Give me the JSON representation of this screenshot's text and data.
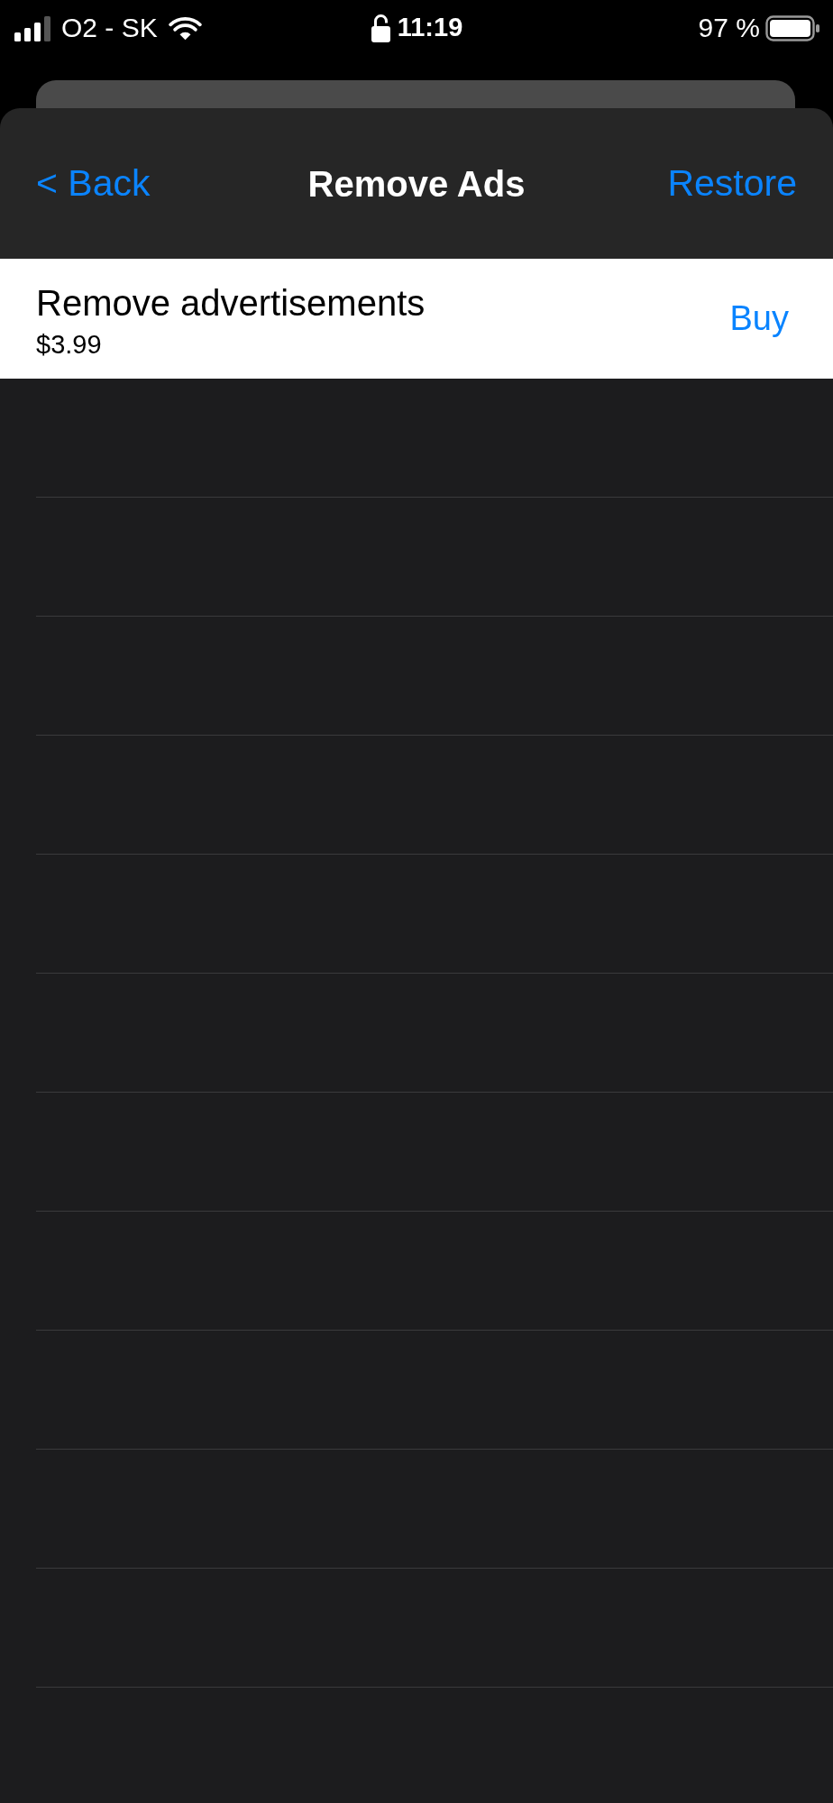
{
  "status_bar": {
    "carrier": "O2 - SK",
    "time": "11:19",
    "battery": "97 %"
  },
  "nav_bar": {
    "back": "< Back",
    "title": "Remove Ads",
    "action": "Restore"
  },
  "products": [
    {
      "name": "Remove advertisements",
      "price": "$3.99",
      "button": "Buy"
    }
  ]
}
